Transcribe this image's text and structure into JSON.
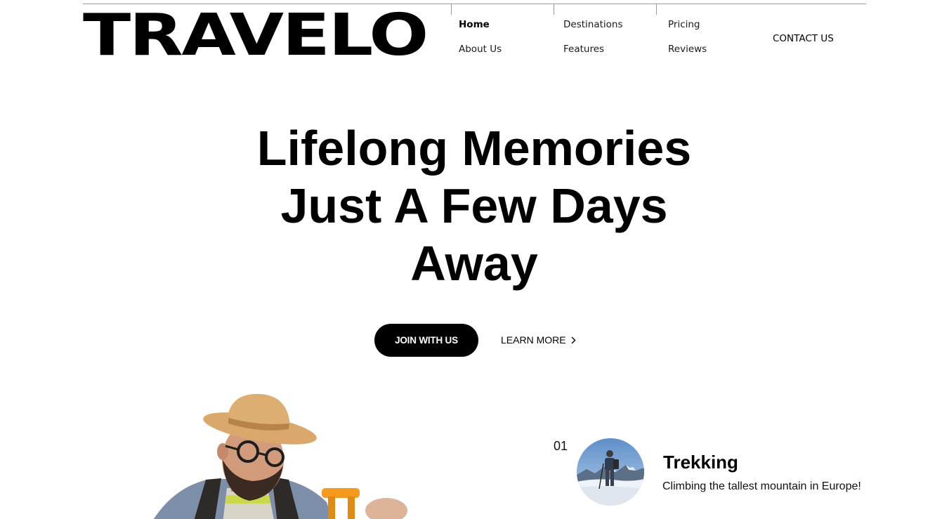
{
  "brand": {
    "logo_text": "TRAVELO"
  },
  "nav": {
    "items": [
      {
        "label": "Home",
        "active": true
      },
      {
        "label": "About Us",
        "active": false
      },
      {
        "label": "Destinations",
        "active": false
      },
      {
        "label": "Features",
        "active": false
      },
      {
        "label": "Pricing",
        "active": false
      },
      {
        "label": "Reviews",
        "active": false
      }
    ],
    "contact_label": "CONTACT US"
  },
  "hero": {
    "title_lines": [
      "Lifelong Memories",
      "Just A Few Days",
      "Away"
    ],
    "primary_button": "JOIN WITH US",
    "secondary_button": "LEARN MORE",
    "secondary_icon": "chevron-right-icon"
  },
  "feature": {
    "number": "01",
    "title": "Trekking",
    "description": "Climbing the tallest mountain in Europe!"
  },
  "colors": {
    "text": "#000000",
    "background": "#ffffff",
    "button_bg": "#000000",
    "button_text": "#ffffff",
    "divider": "#9a9a9a"
  }
}
